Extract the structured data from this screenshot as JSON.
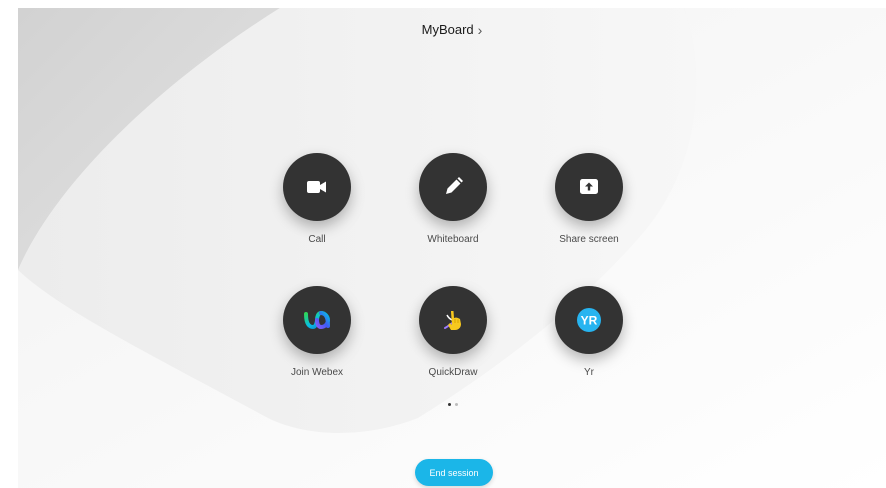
{
  "header": {
    "title": "MyBoard",
    "chevron": "›"
  },
  "apps": [
    {
      "label": "Call",
      "icon": "video-camera-icon"
    },
    {
      "label": "Whiteboard",
      "icon": "pencil-icon"
    },
    {
      "label": "Share screen",
      "icon": "share-screen-icon"
    },
    {
      "label": "Join Webex",
      "icon": "webex-logo-icon"
    },
    {
      "label": "QuickDraw",
      "icon": "quickdraw-hand-icon"
    },
    {
      "label": "Yr",
      "icon": "yr-logo-icon",
      "logo_text": "YR"
    }
  ],
  "pagination": {
    "current": 1,
    "total": 2
  },
  "footer": {
    "end_label": "End session"
  },
  "colors": {
    "tile": "#333333",
    "accent": "#1bb6e8",
    "yr_blue": "#27b4f0"
  }
}
